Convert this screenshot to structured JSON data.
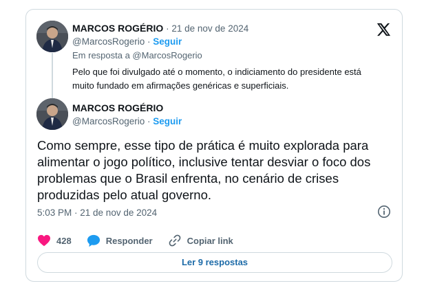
{
  "quoted": {
    "author": "MARCOS ROGÉRIO",
    "date": "· 21 de nov de 2024",
    "handle": "@MarcosRogerio ·",
    "follow": "Seguir",
    "reply_to": "Em resposta a @MarcosRogerio",
    "text_line1": "Pelo que foi divulgado até o momento, o indiciamento do presidente está",
    "text_line2": "muito fundado em afirmações genéricas e superficiais."
  },
  "main": {
    "author": "MARCOS ROGÉRIO",
    "handle": "@MarcosRogerio ·",
    "follow": "Seguir",
    "text_line1": "Como sempre, esse tipo de prática é muito explorada para",
    "text_line2": "alimentar o jogo político, inclusive tentar desviar o foco dos",
    "text_line3": "problemas que o Brasil enfrenta, no cenário de crises",
    "text_line4": "produzidas pelo atual governo.",
    "timestamp": "5:03 PM · 21 de nov de 2024"
  },
  "actions": {
    "likes": "428",
    "reply_label": "Responder",
    "copy_label": "Copiar link"
  },
  "replies_button": "Ler 9 respostas",
  "colors": {
    "accent": "#1d9bf0",
    "like": "#f91880",
    "border": "#cfd9de",
    "muted": "#536471"
  },
  "icons": [
    "x-logo-icon",
    "heart-icon",
    "reply-bubble-icon",
    "link-icon",
    "info-icon"
  ]
}
